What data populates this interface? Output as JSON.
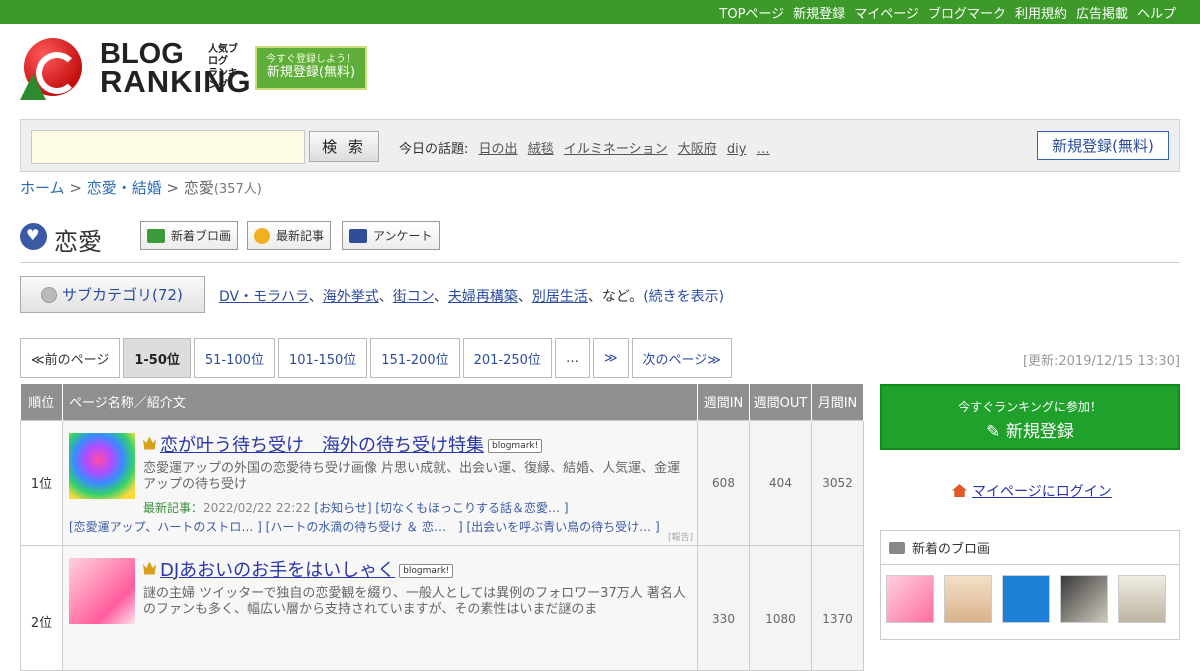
{
  "topnav": [
    "TOPページ",
    "新規登録",
    "マイページ",
    "ブログマーク",
    "利用規約",
    "広告掲載",
    "ヘルプ"
  ],
  "logo": {
    "line1": "BLOG",
    "line2": "RANKING",
    "jp_line1": "人気ブログ",
    "jp_line2": "ランキング"
  },
  "register_banner": {
    "small": "今すぐ登録しよう！",
    "big": "新規登録(無料)"
  },
  "search": {
    "button": "検 索",
    "value": ""
  },
  "topics": {
    "label": "今日の話題:",
    "items": [
      "日の出",
      "絨毯",
      "イルミネーション",
      "大阪府",
      "diy",
      "…"
    ]
  },
  "header_register_button": "新規登録(無料)",
  "breadcrumb": {
    "home": "ホーム",
    "parent": "恋愛・結婚",
    "current": "恋愛",
    "count": "(357人)"
  },
  "category": {
    "title": "恋愛",
    "tabs": [
      "新着ブロ画",
      "最新記事",
      "アンケート"
    ]
  },
  "subcategory": {
    "button": "サブカテゴリ(72)",
    "links": [
      "DV・モラハラ",
      "海外挙式",
      "街コン",
      "夫婦再構築",
      "別居生活"
    ],
    "suffix": "、など。",
    "more": "(続きを表示)"
  },
  "pager": [
    "≪前のページ",
    "1-50位",
    "51-100位",
    "101-150位",
    "151-200位",
    "201-250位",
    "…",
    "≫",
    "次のページ≫"
  ],
  "updated": "[更新:2019/12/15 13:30]",
  "table": {
    "headers": [
      "順位",
      "ページ名称／紹介文",
      "週間IN",
      "週間OUT",
      "月間IN"
    ],
    "rows": [
      {
        "rank": "1位",
        "title": "恋が叶う待ち受け　海外の待ち受け特集",
        "badge": "blogmark!",
        "desc": "恋愛運アップの外国の恋愛待ち受け画像 片思い成就、出会い運、復縁、結婚、人気運、金運アップの待ち受け",
        "latest_label": "最新記事：",
        "latest_date": "2022/02/22 22:22",
        "latest_links": [
          "[お知らせ]",
          "[切なくもほっこりする話＆恋愛… ]"
        ],
        "tags": [
          "[恋愛運アップ、ハートのストロ… ]",
          "[ハートの水滴の待ち受け ＆ 恋…　]",
          "[出会いを呼ぶ青い鳥の待ち受け… ]"
        ],
        "report": "[報告]",
        "week_in": "608",
        "week_out": "404",
        "month_in": "3052"
      },
      {
        "rank": "2位",
        "title": "DJあおいのお手をはいしゃく",
        "badge": "blogmark!",
        "desc": "謎の主婦 ツイッターで独自の恋愛観を綴り、一般人としては異例のフォロワー37万人 著名人のファンも多く、幅広い層から支持されていますが、その素性はいまだ謎のま",
        "week_in": "330",
        "week_out": "1080",
        "month_in": "1370"
      }
    ]
  },
  "join": {
    "small": "今すぐランキングに参加！",
    "big": "新規登録"
  },
  "mypage_login": "マイページにログイン",
  "new_images": {
    "title": "新着のブロ画"
  }
}
